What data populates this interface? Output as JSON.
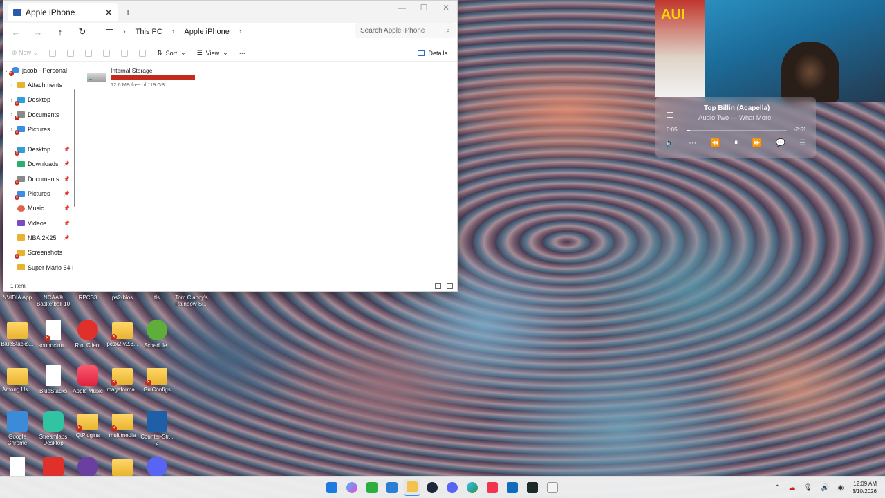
{
  "explorer": {
    "tab_title": "Apple iPhone",
    "new_tab": "+",
    "close": "✕",
    "breadcrumb": [
      "This PC",
      "Apple iPhone"
    ],
    "search_placeholder": "Search Apple iPhone",
    "toolbar": {
      "new": "New",
      "sort": "Sort",
      "view": "View",
      "more": "···",
      "details": "Details"
    },
    "sidebar": {
      "root": "jacob - Personal",
      "cloud_items": [
        "Attachments",
        "Desktop",
        "Documents",
        "Pictures"
      ],
      "quick_items": [
        "Desktop",
        "Downloads",
        "Documents",
        "Pictures",
        "Music",
        "Videos",
        "NBA 2K25",
        "Screenshots",
        "Super Mario 64 I"
      ]
    },
    "drive": {
      "name": "Internal Storage",
      "free_text": "12.6 MB free of 119 GB",
      "used_fraction": 0.9999
    },
    "status": "1 item"
  },
  "desktop_icons": [
    {
      "label": "NVIDIA App"
    },
    {
      "label": "NCAA® Basketball 10"
    },
    {
      "label": "RPCS3"
    },
    {
      "label": "ps2-bios"
    },
    {
      "label": "tls"
    },
    {
      "label": "Tom Clancy's Rainbow Si..."
    },
    {
      "label": "BlueStacks..."
    },
    {
      "label": "soundclou..."
    },
    {
      "label": "Riot Client"
    },
    {
      "label": "pcsx2-v2.3..."
    },
    {
      "label": "Schedule I"
    },
    {
      "label": "Among Us..."
    },
    {
      "label": "BlueStacks"
    },
    {
      "label": "Apple Music"
    },
    {
      "label": "imageforma..."
    },
    {
      "label": "GuiConfigs"
    },
    {
      "label": "Google Chrome"
    },
    {
      "label": "Streamlabs Desktop"
    },
    {
      "label": "QtPlugins"
    },
    {
      "label": "multimedia"
    },
    {
      "label": "Counter-Str... 2"
    }
  ],
  "player": {
    "title": "Top Billin (Acapella)",
    "artist": "Audio Two — What More",
    "elapsed": "0:05",
    "remaining": "-2:51",
    "progress": 0.03
  },
  "webcam": {
    "sign_text": "AUI"
  },
  "clock": {
    "time": "12:09 AM",
    "date": "3/10/2026"
  },
  "colors": {
    "accent": "#3a8ee6",
    "drive_fill": "#c42b1c",
    "error_badge": "#c42b1c"
  }
}
